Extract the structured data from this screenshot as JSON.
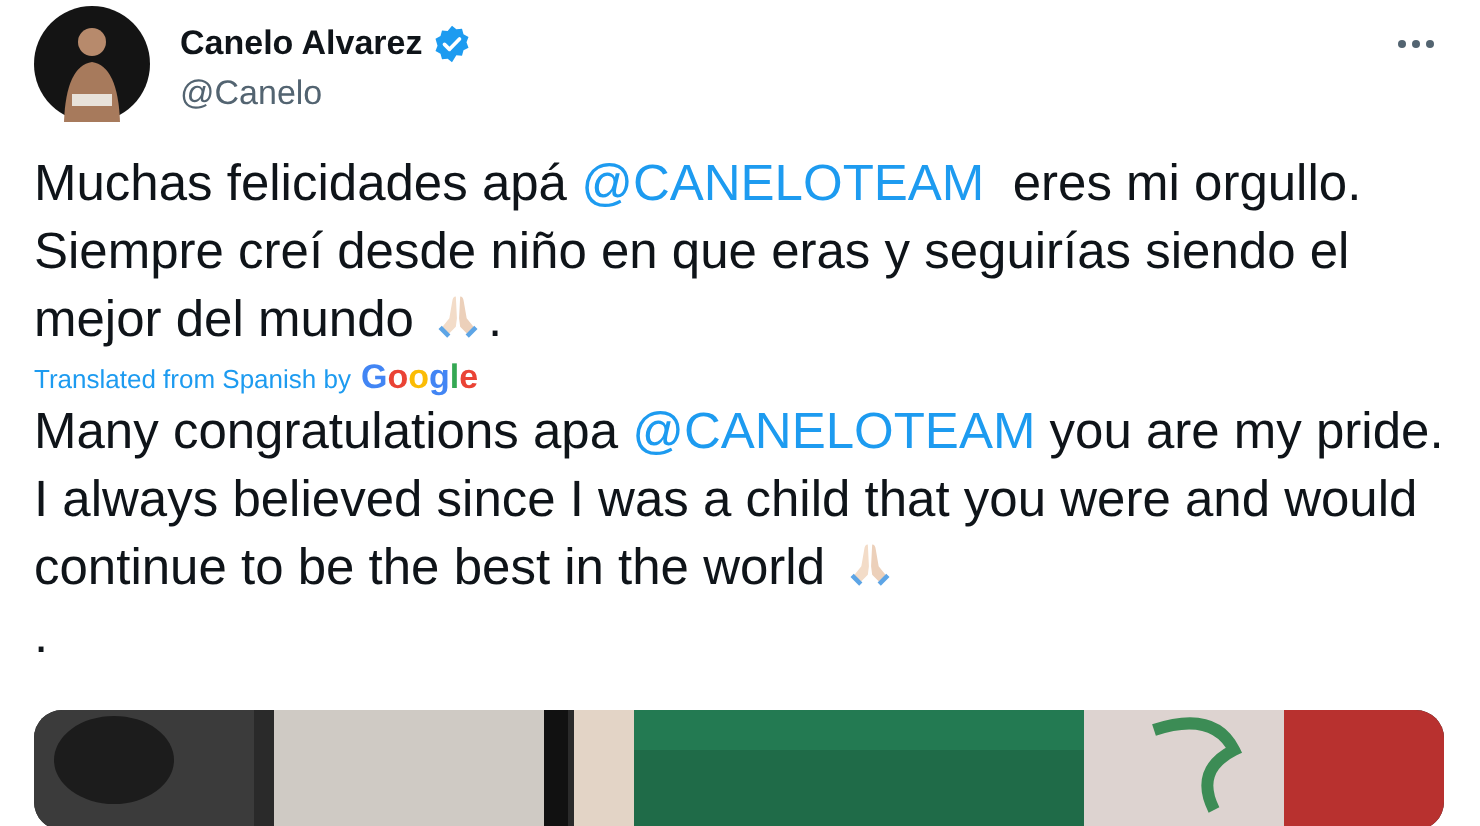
{
  "author": {
    "name": "Canelo Alvarez",
    "handle": "@Canelo",
    "verified": true
  },
  "original_text": [
    {
      "kind": "text",
      "text": "Muchas felicidades apá "
    },
    {
      "kind": "mention",
      "text": "@CANELOTEAM"
    },
    {
      "kind": "text",
      "text": "  eres mi orgullo. Siempre creí desde niño en que eras y seguirías siendo el mejor del mundo "
    },
    {
      "kind": "emoji"
    },
    {
      "kind": "text",
      "text": "."
    }
  ],
  "translation_note": {
    "label": "Translated from Spanish by",
    "provider": "Google"
  },
  "translated_text": [
    {
      "kind": "text",
      "text": "Many congratulations apa "
    },
    {
      "kind": "mention",
      "text": "@CANELOTEAM"
    },
    {
      "kind": "text",
      "text": " you are my pride. I always believed since I was a child that you were and would continue to be the best in the world "
    },
    {
      "kind": "emoji"
    },
    {
      "kind": "break"
    },
    {
      "kind": "text",
      "text": "."
    }
  ]
}
